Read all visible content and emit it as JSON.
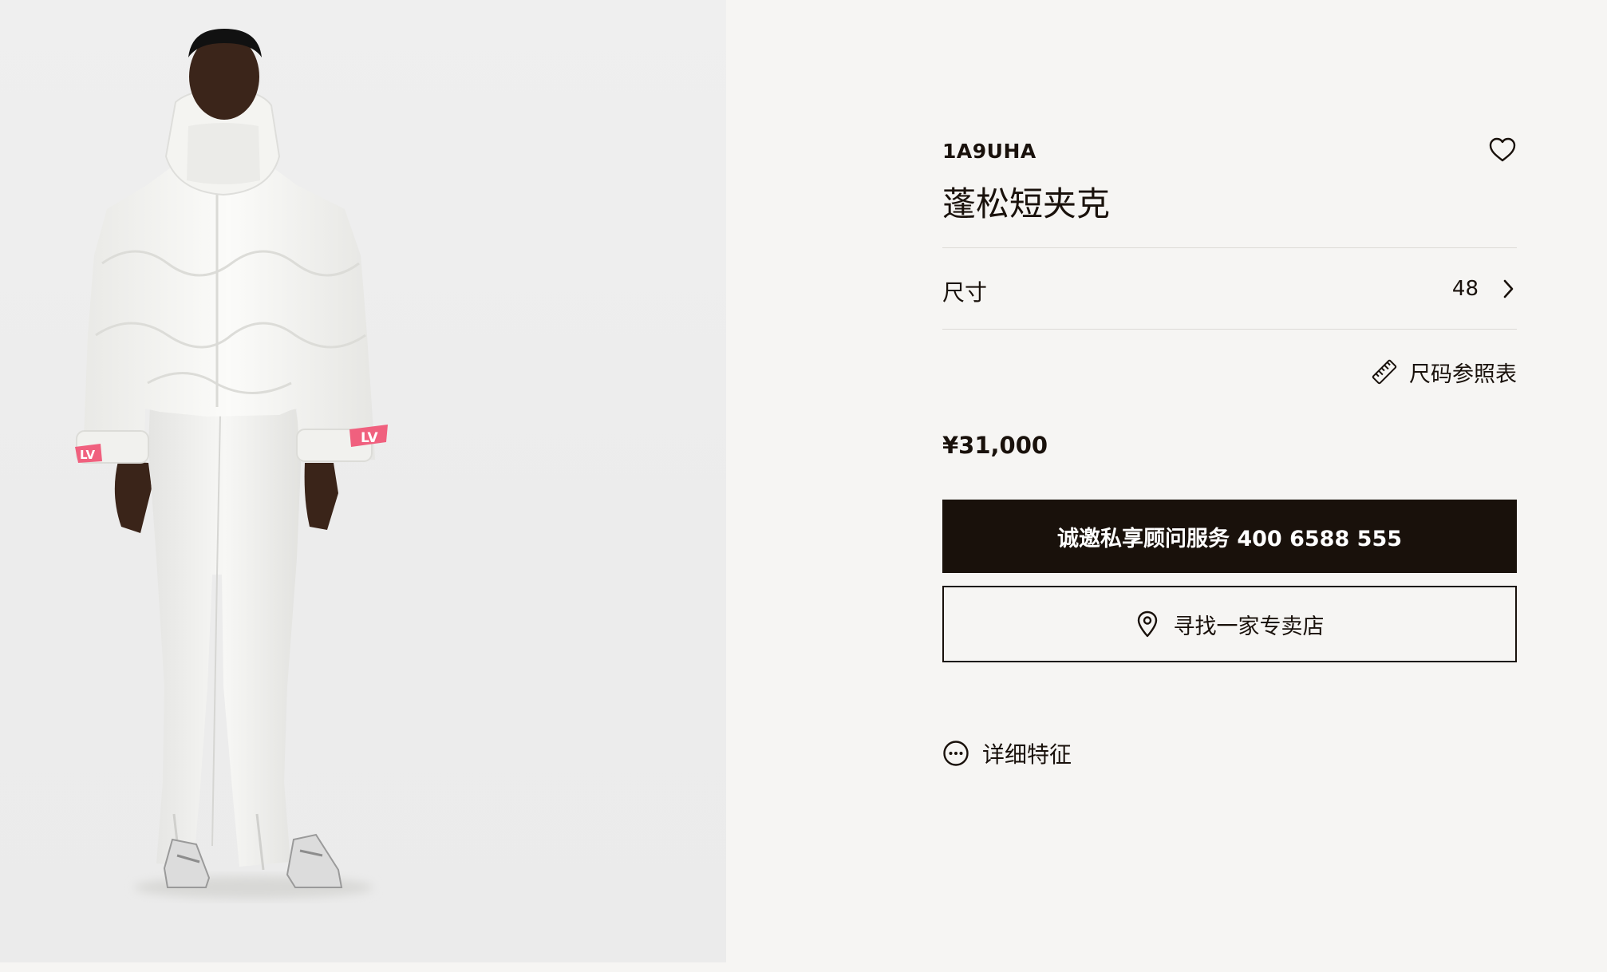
{
  "product": {
    "sku": "1A9UHA",
    "name": "蓬松短夹克",
    "image_alt": "Model wearing white cropped puffer jacket with pink LV cuff tabs and white flared trousers",
    "logo_text": "LV"
  },
  "size": {
    "label": "尺寸",
    "value": "48"
  },
  "size_guide": {
    "label": "尺码参照表"
  },
  "price": "¥31,000",
  "actions": {
    "advisor_label": "诚邀私享顾问服务 400 6588 555",
    "find_store_label": "寻找一家专卖店"
  },
  "details_link": {
    "label": "详细特征"
  },
  "icons": {
    "wishlist": "heart-icon",
    "size_chevron": "chevron-right-icon",
    "size_guide": "ruler-icon",
    "store": "location-pin-icon",
    "details": "more-dots-circle-icon"
  },
  "colors": {
    "ink": "#19110b",
    "page_background": "#f6f5f3",
    "accent_pink": "#f0607e"
  }
}
